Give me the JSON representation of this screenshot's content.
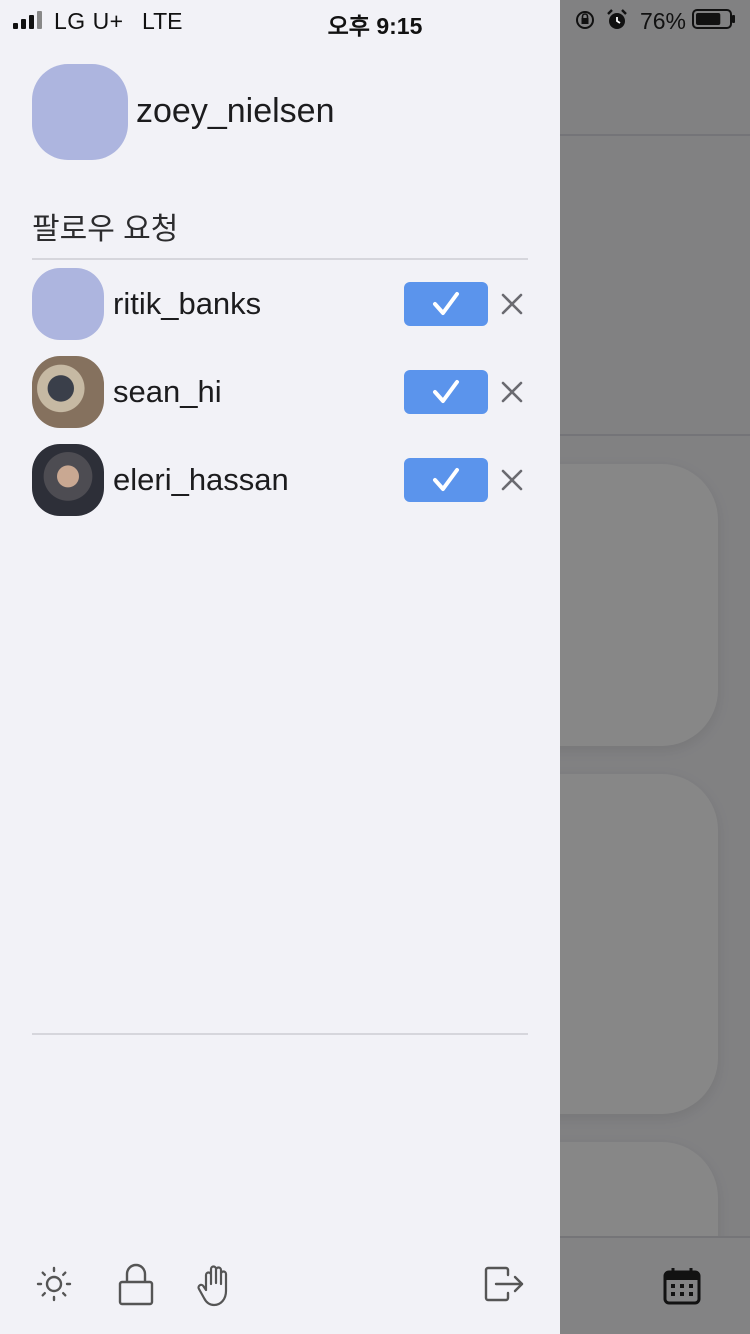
{
  "status_bar": {
    "carrier": "LG U+",
    "network": "LTE",
    "time": "오후 9:15",
    "battery_percent": "76%",
    "battery_level": 0.76
  },
  "drawer": {
    "profile": {
      "username": "zoey_nielsen",
      "avatar_color": "#adb5df"
    },
    "section_title": "팔로우 요청",
    "requests": [
      {
        "username": "ritik_banks",
        "avatar": "placeholder"
      },
      {
        "username": "sean_hi",
        "avatar": "photo"
      },
      {
        "username": "eleri_hassan",
        "avatar": "photo"
      }
    ],
    "toolbar_icons": [
      "brightness-icon",
      "lock-icon",
      "hand-icon",
      "logout-icon"
    ]
  },
  "colors": {
    "accent": "#5b94ec",
    "drawer_bg": "#f2f2f7",
    "avatar_placeholder": "#adb5df"
  }
}
